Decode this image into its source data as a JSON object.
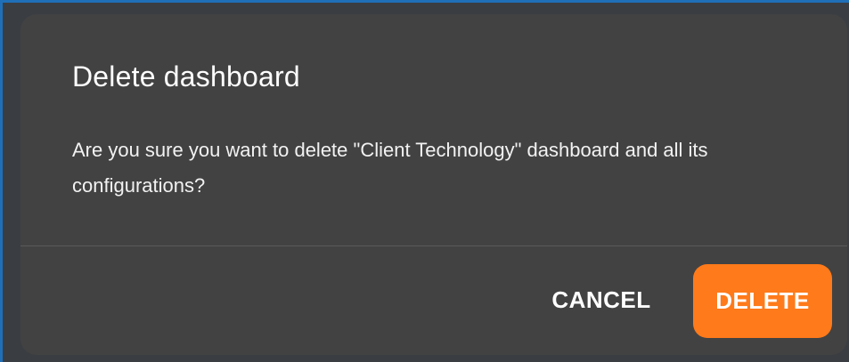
{
  "dialog": {
    "title": "Delete dashboard",
    "message": "Are you sure you want to delete \"Client Technology\" dashboard and all its configurations?",
    "cancel_label": "CANCEL",
    "delete_label": "DELETE"
  },
  "colors": {
    "dialog_background": "#424242",
    "accent": "#ff7a1a",
    "text": "#ffffff"
  }
}
